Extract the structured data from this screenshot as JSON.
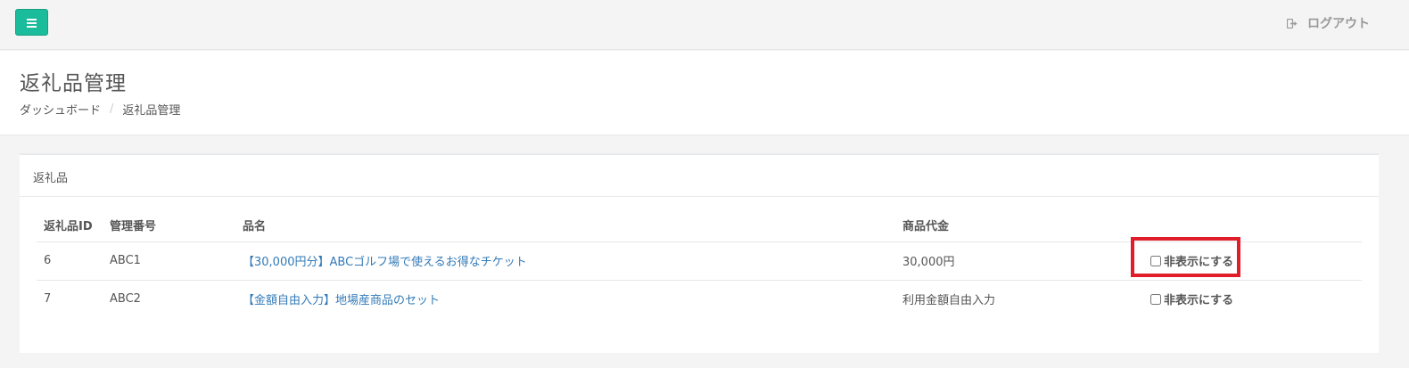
{
  "topbar": {
    "menu_icon": "hamburger-icon",
    "accent_color": "#1abc9c",
    "logout_label": "ログアウト",
    "logout_icon": "sign-out-icon"
  },
  "header": {
    "title": "返礼品管理",
    "breadcrumb": [
      "ダッシュボード",
      "返礼品管理"
    ]
  },
  "panel": {
    "title": "返礼品",
    "columns": [
      "返礼品ID",
      "管理番号",
      "品名",
      "商品代金",
      ""
    ],
    "rows": [
      {
        "id": "6",
        "code": "ABC1",
        "name": "【30,000円分】ABCゴルフ場で使えるお得なチケット",
        "price": "30,000円",
        "hide_label": "非表示にする",
        "hidden": false
      },
      {
        "id": "7",
        "code": "ABC2",
        "name": "【金額自由入力】地場産商品のセット",
        "price": "利用金額自由入力",
        "hide_label": "非表示にする",
        "hidden": false
      }
    ]
  },
  "highlight_color": "#e11d2a"
}
